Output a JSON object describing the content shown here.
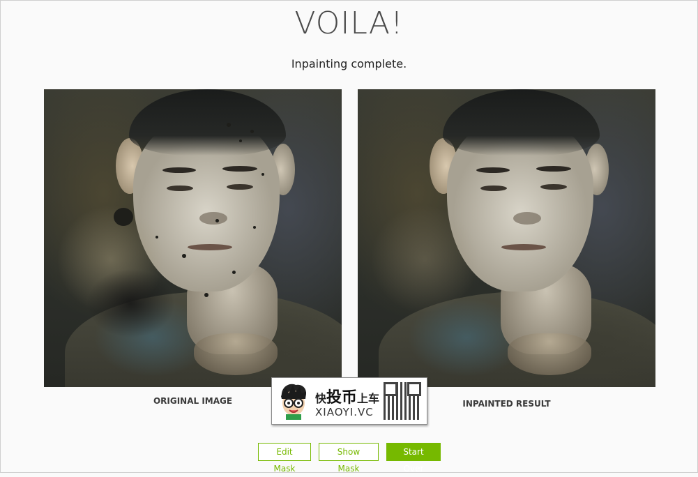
{
  "header": {
    "title": "VOILA!",
    "subtitle": "Inpainting complete."
  },
  "images": {
    "original_label": "ORIGINAL IMAGE",
    "result_label": "INPAINTED RESULT"
  },
  "watermark": {
    "line1_a": "快",
    "line1_b": "投币",
    "line1_c": "上车",
    "line2": "XIAOYI.VC"
  },
  "actions": {
    "edit_mask": "Edit Mask",
    "show_mask": "Show Mask",
    "start_over": "Start Over"
  },
  "colors": {
    "accent": "#76b900"
  }
}
